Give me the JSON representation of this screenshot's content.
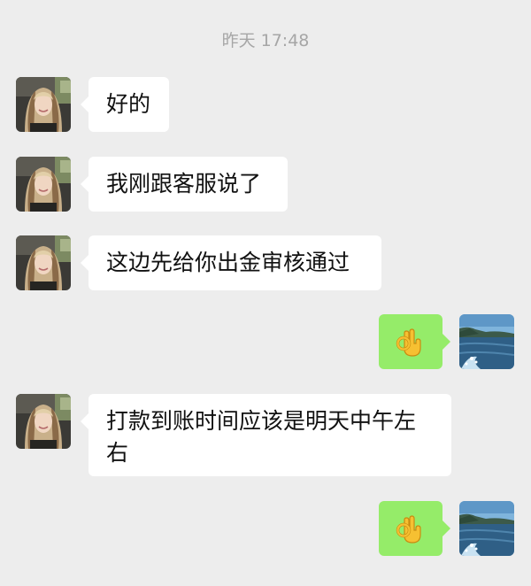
{
  "chat": {
    "timestamp": "昨天 17:48",
    "messages": [
      {
        "sender": "contact",
        "text": "好的"
      },
      {
        "sender": "contact",
        "text": "我刚跟客服说了"
      },
      {
        "sender": "contact",
        "text": "这边先给你出金审核通过"
      },
      {
        "sender": "me",
        "content": "ok-hand-emoji"
      },
      {
        "sender": "contact",
        "text": "打款到账时间应该是明天中午左右"
      },
      {
        "sender": "me",
        "content": "ok-hand-emoji"
      }
    ]
  },
  "colors": {
    "background": "#ededed",
    "incoming_bubble": "#ffffff",
    "outgoing_bubble": "#95ec69",
    "timestamp_text": "#a6a6a6"
  }
}
